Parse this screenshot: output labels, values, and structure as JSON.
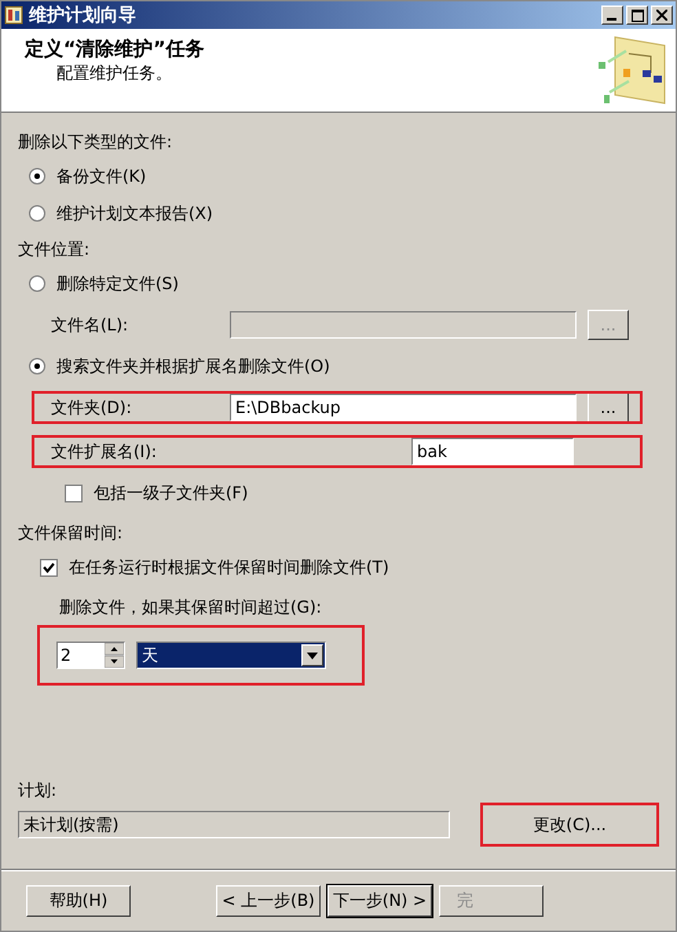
{
  "window": {
    "title": "维护计划向导"
  },
  "header": {
    "title": "定义“清除维护”任务",
    "subtitle": "配置维护任务。"
  },
  "file_type": {
    "label": "删除以下类型的文件:",
    "options": [
      {
        "label": "备份文件(K)",
        "selected": true
      },
      {
        "label": "维护计划文本报告(X)",
        "selected": false
      }
    ]
  },
  "location": {
    "label": "文件位置:",
    "specific": {
      "label": "删除特定文件(S)",
      "selected": false,
      "field_label": "文件名(L):",
      "field_disabled": true,
      "browse": "..."
    },
    "search": {
      "label": "搜索文件夹并根据扩展名删除文件(O)",
      "selected": true
    },
    "folder": {
      "label": "文件夹(D):",
      "value": "E:\\DBbackup",
      "browse": "...",
      "highlighted": true
    },
    "extension": {
      "label": "文件扩展名(I):",
      "value": "bak",
      "highlighted": true
    },
    "subfolders": {
      "label": "包括一级子文件夹(F)",
      "checked": false
    }
  },
  "retention": {
    "label": "文件保留时间:",
    "enable": {
      "label": "在任务运行时根据文件保留时间删除文件(T)",
      "checked": true
    },
    "older_than": {
      "label": "删除文件，如果其保留时间超过(G):",
      "value": "2",
      "unit": "天",
      "highlighted": true
    }
  },
  "schedule": {
    "label": "计划:",
    "value": "未计划(按需)",
    "button": "更改(C)...",
    "highlighted": true
  },
  "buttons": [
    {
      "label": "帮助(H)",
      "disabled": false
    },
    {
      "label": "< 上一步(B)",
      "disabled": false
    },
    {
      "label": "下一步(N) >",
      "disabled": false
    },
    {
      "label": "完",
      "disabled": true
    }
  ]
}
